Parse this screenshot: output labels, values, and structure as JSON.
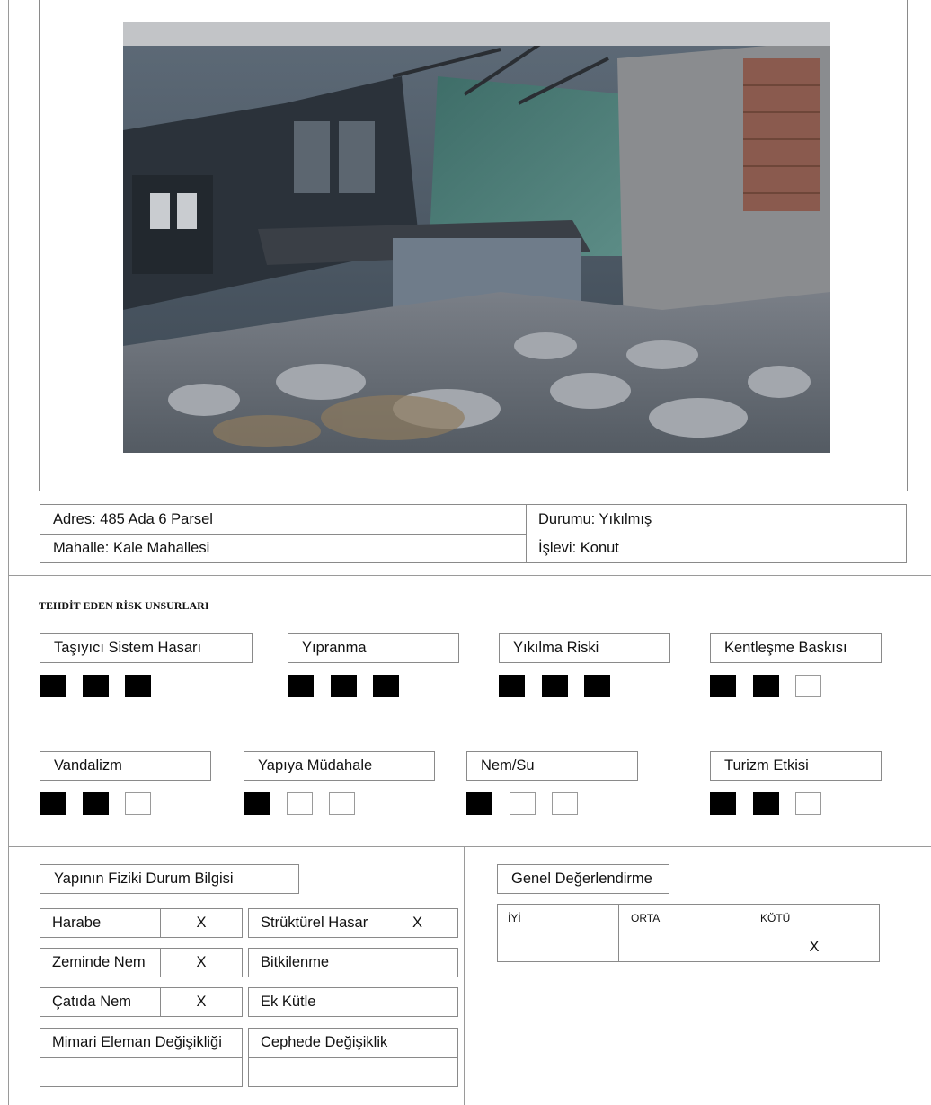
{
  "info": {
    "address": "Adres: 485 Ada 6 Parsel",
    "neighborhood": "Mahalle: Kale Mahallesi",
    "status": "Durumu: Yıkılmış",
    "function": "İşlevi: Konut"
  },
  "risks": {
    "title": "TEHDİT EDEN RİSK UNSURLARI",
    "items": [
      {
        "label": "Taşıyıcı Sistem Hasarı",
        "level": 3
      },
      {
        "label": "Yıpranma",
        "level": 3
      },
      {
        "label": "Yıkılma Riski",
        "level": 3
      },
      {
        "label": "Kentleşme Baskısı",
        "level": 2
      },
      {
        "label": "Vandalizm",
        "level": 2
      },
      {
        "label": "Yapıya Müdahale",
        "level": 1
      },
      {
        "label": "Nem/Su",
        "level": 1
      },
      {
        "label": "Turizm Etkisi",
        "level": 2
      }
    ]
  },
  "physical": {
    "title": "Yapının Fiziki Durum Bilgisi",
    "rows": [
      {
        "label": "Harabe",
        "mark": "X"
      },
      {
        "label": "Zeminde Nem",
        "mark": "X"
      },
      {
        "label": "Çatıda Nem",
        "mark": "X"
      },
      {
        "label": "Strüktürel Hasar",
        "mark": "X"
      },
      {
        "label": "Bitkilenme",
        "mark": ""
      },
      {
        "label": "Ek Kütle",
        "mark": ""
      }
    ],
    "arch_change": "Mimari Eleman Değişikliği",
    "facade_change": "Cephede Değişiklik"
  },
  "evaluation": {
    "title": "Genel Değerlendirme",
    "headers": [
      "İYİ",
      "ORTA",
      "KÖTÜ"
    ],
    "marks": [
      "",
      "",
      "X"
    ]
  },
  "colors": {
    "border": "#8a8a8a",
    "filled": "#000000",
    "empty": "#ffffff"
  }
}
